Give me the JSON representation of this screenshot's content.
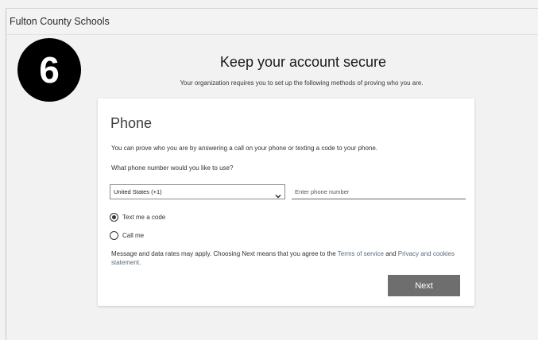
{
  "topbar": {
    "org_name": "Fulton County Schools"
  },
  "step_badge": {
    "number": "6"
  },
  "header": {
    "title": "Keep your account secure",
    "subtitle": "Your organization requires you to set up the following methods of proving who you are."
  },
  "card": {
    "title": "Phone",
    "description": "You can prove who you are by answering a call on your phone or texting a code to your phone.",
    "question": "What phone number would you like to use?",
    "country_select": {
      "selected": "United States (+1)"
    },
    "phone_input": {
      "placeholder": "Enter phone number",
      "value": ""
    },
    "options": [
      {
        "label": "Text me a code",
        "checked": true
      },
      {
        "label": "Call me",
        "checked": false
      }
    ],
    "disclaimer": {
      "prefix": "Message and data rates may apply. Choosing Next means that you agree to the ",
      "terms_link": "Terms of service",
      "middle": " and ",
      "privacy_link": "Privacy and cookies statement",
      "suffix": "."
    },
    "next_label": "Next"
  },
  "colors": {
    "background": "#f2f2f2",
    "card": "#ffffff",
    "button": "#6e6e6e",
    "badge": "#000000",
    "link": "#5b6b7b"
  },
  "icons": {
    "select_arrow": "chevron-down-icon"
  }
}
